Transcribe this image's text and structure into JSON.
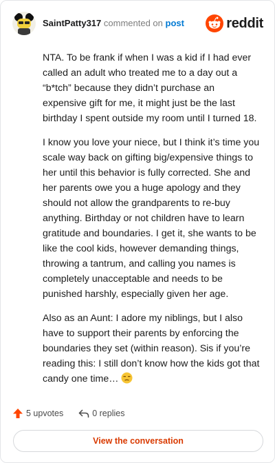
{
  "header": {
    "username": "SaintPatty317",
    "action": "commented on",
    "link": "post",
    "brand": "reddit"
  },
  "comment": {
    "paragraphs": [
      "NTA. To be frank if when I was a kid if I had ever called an adult who treated me to a day out a “b*tch” because they didn’t purchase an expensive gift for me, it might just be the last birthday I spent outside my room until I turned 18.",
      "I know you love your niece, but I think it’s time you scale way back on gifting big/expensive things to her until this behavior is fully corrected. She and her parents owe you a huge apology and they should not allow the grandparents to re-buy anything. Birthday or not children have to learn gratitude and boundaries. I get it, she wants to be like the cool kids, however demanding things, throwing a tantrum, and calling you names is completely unacceptable and needs to be punished harshly, especially given her age.",
      "Also as an Aunt: I adore my niblings, but I also have to support their parents by enforcing the boundaries they set (within reason). Sis if you’re reading this: I still don’t know how the kids got that candy one time…"
    ],
    "emoji": "unamused-face"
  },
  "footer": {
    "upvotes": "5 upvotes",
    "replies": "0 replies"
  },
  "cta": {
    "label": "View the conversation"
  },
  "colors": {
    "upvote": "#ff4500",
    "brand": "#ff4500",
    "link": "#0079d3",
    "cta_text": "#d93a00"
  }
}
